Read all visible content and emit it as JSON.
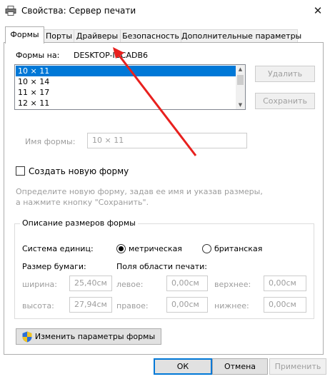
{
  "window": {
    "title": "Свойства: Сервер печати",
    "close_icon": "close-icon",
    "app_icon": "printer-icon"
  },
  "tabs": [
    {
      "label": "Формы",
      "active": true
    },
    {
      "label": "Порты",
      "active": false
    },
    {
      "label": "Драйверы",
      "active": false
    },
    {
      "label": "Безопасность",
      "active": false
    },
    {
      "label": "Дополнительные параметры",
      "active": false
    }
  ],
  "forms": {
    "forms_on_label": "Формы на:",
    "server_name": "DESKTOP-IUCADB6",
    "list": [
      "10 × 11",
      "10 × 14",
      "11 × 17",
      "12 × 11"
    ],
    "selected_index": 0,
    "delete_button": "Удалить",
    "save_button": "Сохранить",
    "form_name_label": "Имя формы:",
    "form_name_value": "10 × 11",
    "create_new_label": "Создать новую форму",
    "create_new_checked": false,
    "hint": "Определите новую форму, задав ее имя и указав размеры,\nа нажмите кнопку \"Сохранить\"."
  },
  "description": {
    "group_title": "Описание размеров формы",
    "units_label": "Система единиц:",
    "metric_label": "метрическая",
    "imperial_label": "британская",
    "metric_selected": true,
    "paper_size_label": "Размер бумаги:",
    "print_area_label": "Поля области печати:",
    "width_label": "ширина:",
    "width_value": "25,40см",
    "height_label": "высота:",
    "height_value": "27,94см",
    "left_label": "левое:",
    "left_value": "0,00см",
    "right_label": "правое:",
    "right_value": "0,00см",
    "top_label": "верхнее:",
    "top_value": "0,00см",
    "bottom_label": "нижнее:",
    "bottom_value": "0,00см",
    "change_settings_button": "Изменить параметры формы",
    "shield_icon": "uac-shield-icon"
  },
  "footer": {
    "ok": "ОК",
    "cancel": "Отмена",
    "apply": "Применить"
  },
  "annotation": {
    "arrow_color": "#e8201e"
  }
}
